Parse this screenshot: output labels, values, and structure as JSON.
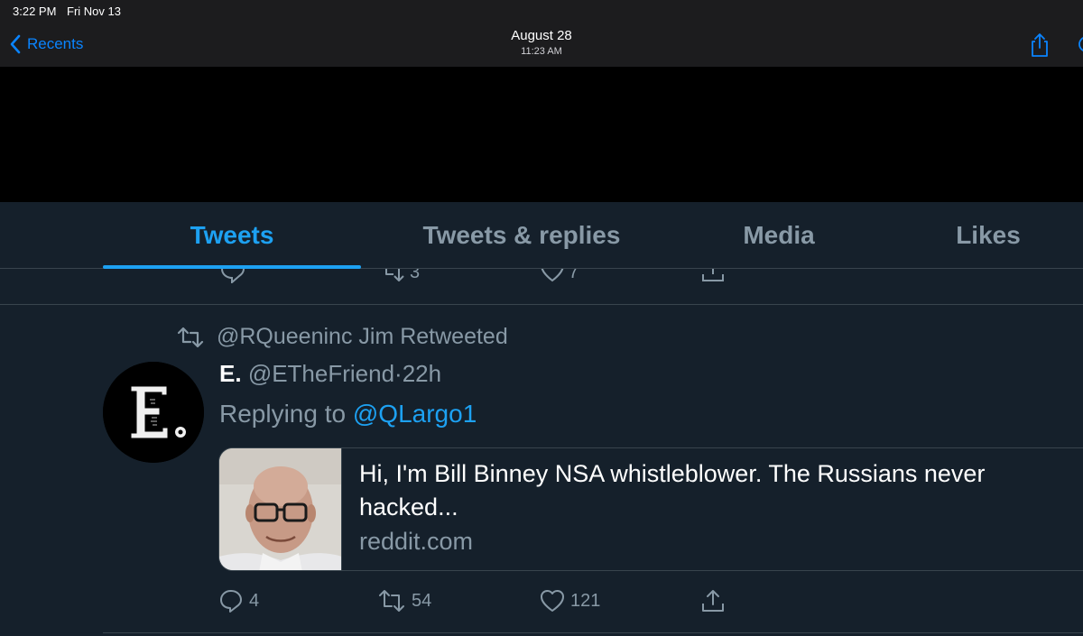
{
  "status_bar": {
    "time": "3:22 PM",
    "date": "Fri Nov 13"
  },
  "nav": {
    "back_label": "Recents",
    "title": "August 28",
    "subtitle": "11:23 AM"
  },
  "tabs": [
    {
      "label": "Tweets",
      "active": true
    },
    {
      "label": "Tweets & replies",
      "active": false
    },
    {
      "label": "Media",
      "active": false
    },
    {
      "label": "Likes",
      "active": false
    }
  ],
  "previous_tweet": {
    "retweets": "3",
    "likes": "7"
  },
  "tweet": {
    "retweeted_by": "@RQueeninc Jim Retweeted",
    "author_name": "E.",
    "author_handle": "@ETheFriend",
    "time": "·22h",
    "replying_prefix": "Replying to ",
    "replying_to": "@QLargo1",
    "card": {
      "title": "Hi, I'm Bill Binney NSA whistleblower. The Russians never hacked...",
      "domain": "reddit.com"
    },
    "replies": "4",
    "retweets": "54",
    "likes": "121"
  },
  "colors": {
    "accent": "#1da1f2",
    "background": "#15202b",
    "muted": "#8899a6",
    "ios_link": "#0a84ff"
  }
}
